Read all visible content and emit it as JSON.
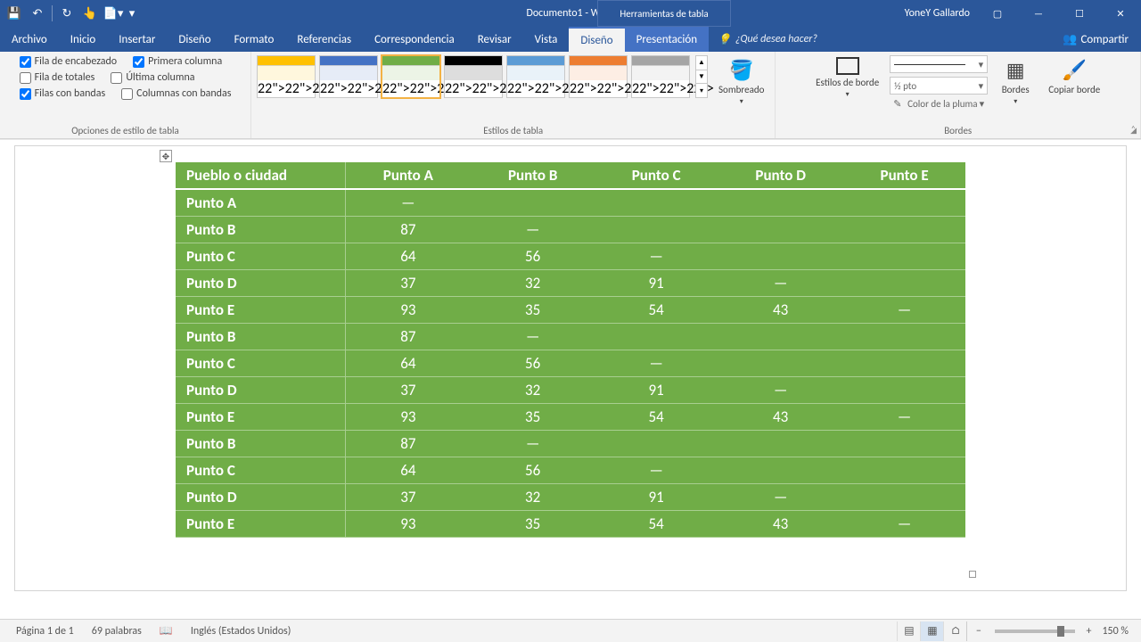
{
  "title": {
    "doc": "Documento1",
    "app": " - Word",
    "context_tool": "Herramientas de tabla",
    "user": "YoneY Gallardo"
  },
  "qat": {
    "save": "💾",
    "undo": "↶",
    "redo": "↻",
    "touch": "👆",
    "new": "📄▾",
    "more": "▾"
  },
  "tabs": {
    "items": [
      "Archivo",
      "Inicio",
      "Insertar",
      "Diseño",
      "Formato",
      "Referencias",
      "Correspondencia",
      "Revisar",
      "Vista"
    ],
    "context": [
      "Diseño",
      "Presentación"
    ],
    "active_context_index": 0,
    "tell_me": "¿Qué desea hacer?",
    "share": "Compartir"
  },
  "ribbon": {
    "options_group_label": "Opciones de estilo de tabla",
    "opts": {
      "header_row": "Fila de encabezado",
      "total_row": "Fila de totales",
      "banded_rows": "Filas con bandas",
      "first_col": "Primera columna",
      "last_col": "Última columna",
      "banded_cols": "Columnas con bandas",
      "checked": {
        "header_row": true,
        "total_row": false,
        "banded_rows": true,
        "first_col": true,
        "last_col": false,
        "banded_cols": false
      }
    },
    "styles_group_label": "Estilos de tabla",
    "shading": "Sombreado",
    "border_styles": "Estilos de borde",
    "border_group_label": "Bordes",
    "pen_weight": "½ pto",
    "pen_color": "Color de la pluma",
    "borders": "Bordes",
    "copy_border": "Copiar borde"
  },
  "table": {
    "headers": [
      "Pueblo o ciudad",
      "Punto A",
      "Punto B",
      "Punto C",
      "Punto D",
      "Punto E"
    ],
    "rows": [
      {
        "label": "Punto A",
        "cells": [
          "—",
          "",
          "",
          "",
          ""
        ]
      },
      {
        "label": "Punto B",
        "cells": [
          "87",
          "—",
          "",
          "",
          ""
        ]
      },
      {
        "label": "Punto C",
        "cells": [
          "64",
          "56",
          "—",
          "",
          ""
        ]
      },
      {
        "label": "Punto D",
        "cells": [
          "37",
          "32",
          "91",
          "—",
          ""
        ]
      },
      {
        "label": "Punto E",
        "cells": [
          "93",
          "35",
          "54",
          "43",
          "—"
        ]
      },
      {
        "label": "Punto B",
        "cells": [
          "87",
          "—",
          "",
          "",
          ""
        ]
      },
      {
        "label": "Punto C",
        "cells": [
          "64",
          "56",
          "—",
          "",
          ""
        ]
      },
      {
        "label": "Punto D",
        "cells": [
          "37",
          "32",
          "91",
          "—",
          ""
        ]
      },
      {
        "label": "Punto E",
        "cells": [
          "93",
          "35",
          "54",
          "43",
          "—"
        ]
      },
      {
        "label": "Punto B",
        "cells": [
          "87",
          "—",
          "",
          "",
          ""
        ]
      },
      {
        "label": "Punto C",
        "cells": [
          "64",
          "56",
          "—",
          "",
          ""
        ]
      },
      {
        "label": "Punto D",
        "cells": [
          "37",
          "32",
          "91",
          "—",
          ""
        ]
      },
      {
        "label": "Punto E",
        "cells": [
          "93",
          "35",
          "54",
          "43",
          "—"
        ]
      }
    ]
  },
  "status": {
    "page": "Página 1 de 1",
    "words": "69 palabras",
    "lang": "Inglés (Estados Unidos)",
    "zoom": "150 %"
  },
  "style_colors": [
    "#ffc000",
    "#4472c4",
    "#70ad47",
    "#000000",
    "#5b9bd5",
    "#ed7d31",
    "#a5a5a5"
  ]
}
